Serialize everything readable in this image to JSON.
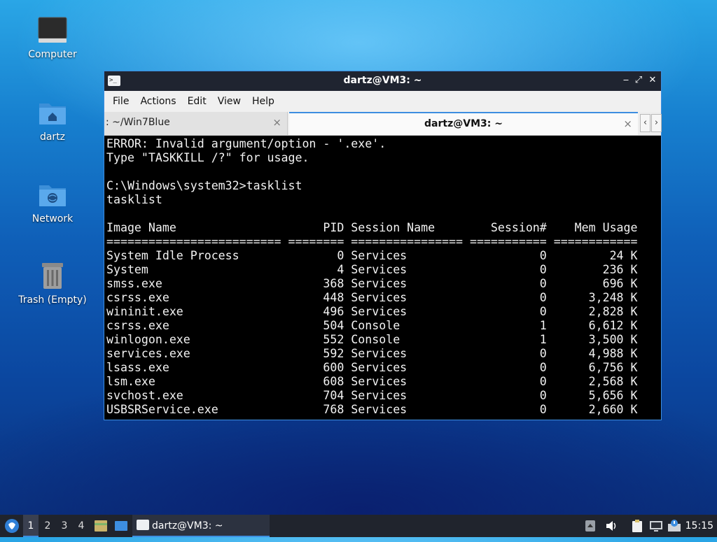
{
  "desktop": {
    "icons": [
      {
        "label": "Computer",
        "icon": "monitor-icon"
      },
      {
        "label": "dartz",
        "icon": "home-folder-icon"
      },
      {
        "label": "Network",
        "icon": "network-folder-icon"
      },
      {
        "label": "Trash (Empty)",
        "icon": "trash-icon"
      }
    ]
  },
  "window": {
    "title": "dartz@VM3: ~",
    "controls": {
      "minimize": "‒",
      "maximize": "⤢",
      "close": "✕"
    },
    "menu": [
      "File",
      "Actions",
      "Edit",
      "View",
      "Help"
    ],
    "tabs": [
      {
        "label": ": ~/Win7Blue",
        "close": "×",
        "active": false
      },
      {
        "label": "dartz@VM3: ~",
        "close": "×",
        "active": true
      }
    ],
    "tab_nav": {
      "prev": "‹",
      "next": "›"
    }
  },
  "terminal": {
    "lines": [
      "ERROR: Invalid argument/option - '.exe'.",
      "Type \"TASKKILL /?\" for usage.",
      "",
      "C:\\Windows\\system32>tasklist",
      "tasklist",
      "",
      "Image Name                     PID Session Name        Session#    Mem Usage",
      "========================= ======== ================ =========== ============",
      "System Idle Process              0 Services                   0         24 K",
      "System                           4 Services                   0        236 K",
      "smss.exe                       368 Services                   0        696 K",
      "csrss.exe                      448 Services                   0      3,248 K",
      "wininit.exe                    496 Services                   0      2,828 K",
      "csrss.exe                      504 Console                    1      6,612 K",
      "winlogon.exe                   552 Console                    1      3,500 K",
      "services.exe                   592 Services                   0      4,988 K",
      "lsass.exe                      600 Services                   0      6,756 K",
      "lsm.exe                        608 Services                   0      2,568 K",
      "svchost.exe                    704 Services                   0      5,656 K",
      "USBSRService.exe               768 Services                   0      2,660 K"
    ]
  },
  "taskbar": {
    "workspaces": [
      "1",
      "2",
      "3",
      "4"
    ],
    "active_workspace": "1",
    "task_label": "dartz@VM3: ~",
    "clock": "15:15"
  },
  "colors": {
    "accent": "#3d8ee0",
    "titlebar": "#1f2430",
    "taskbar": "#20242d",
    "terminal_bg": "#000000",
    "terminal_fg": "#f2f2f2"
  }
}
